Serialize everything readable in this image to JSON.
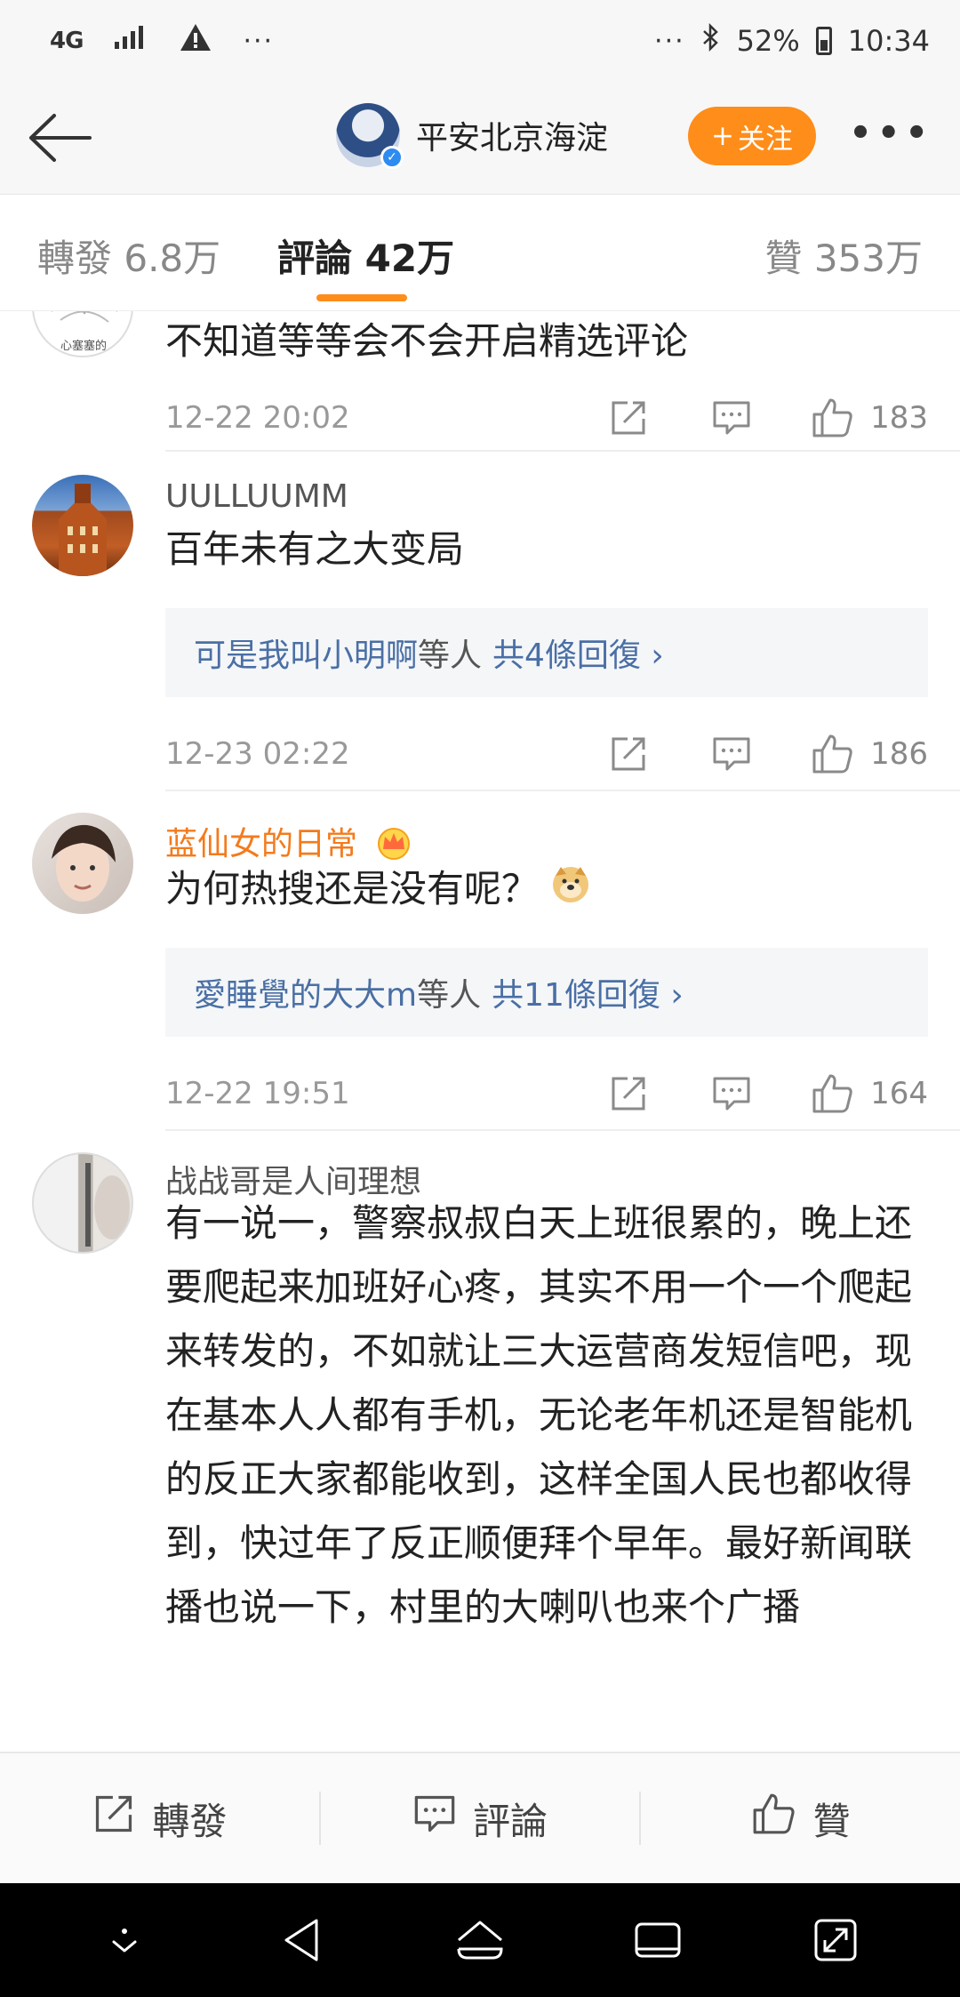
{
  "status_bar": {
    "network": "4G",
    "more_dots": "···",
    "right_dots": "···",
    "battery": "52%",
    "time": "10:34"
  },
  "header": {
    "account_name": "平安北京海淀",
    "follow_label": "关注",
    "follow_plus": "+"
  },
  "tabs": {
    "repost": "轉發 6.8万",
    "comment": "評論 42万",
    "like": "贊 353万"
  },
  "comments": [
    {
      "avatar_caption": "心塞塞的",
      "text": "不知道等等会不会开启精选评论",
      "date": "12-22 20:02",
      "likes": "183"
    },
    {
      "username": "UULLUUMM",
      "text": "百年未有之大变局",
      "reply_user": "可是我叫小明啊",
      "reply_etc": "等人",
      "reply_count": "共4條回復 ›",
      "date": "12-23 02:22",
      "likes": "186"
    },
    {
      "username": "蓝仙女的日常",
      "text": "为何热搜还是没有呢？",
      "reply_user": "愛睡覺的大大m",
      "reply_etc": "等人",
      "reply_count": "共11條回復 ›",
      "date": "12-22 19:51",
      "likes": "164"
    },
    {
      "username": "战战哥是人间理想",
      "text": "有一说一，警察叔叔白天上班很累的，晚上还要爬起来加班好心疼，其实不用一个一个爬起来转发的，不如就让三大运营商发短信吧，现在基本人人都有手机，无论老年机还是智能机的反正大家都能收到，这样全国人民也都收得到，快过年了反正顺便拜个早年。最好新闻联播也说一下，村里的大喇叭也来个广播"
    }
  ],
  "bottom_bar": {
    "repost": "轉發",
    "comment": "評論",
    "like": "贊"
  },
  "colors": {
    "accent": "#ff8d1a",
    "link": "#4a6fa5",
    "vip_name": "#f37b1d"
  }
}
